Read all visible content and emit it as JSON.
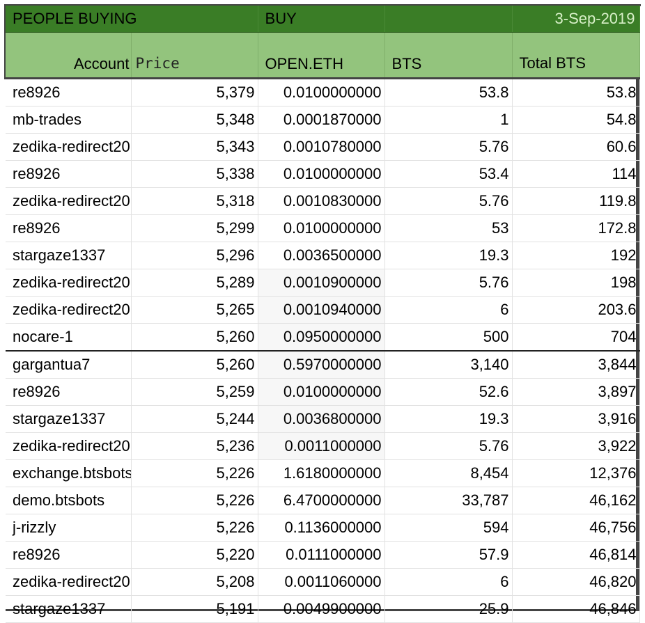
{
  "sheet": {
    "title_left": "PEOPLE BUYING",
    "title_mid": "BUY",
    "date": "3-Sep-2019",
    "headers": {
      "account": "Account",
      "price": "Price",
      "open_eth": "OPEN.ETH",
      "bts": "BTS",
      "total_bts": "Total BTS"
    },
    "rows": [
      {
        "account": "re8926",
        "price": "5,379",
        "eth": "0.0100000000",
        "bts": "53.8",
        "total": "53.8"
      },
      {
        "account": "mb-trades",
        "price": "5,348",
        "eth": "0.0001870000",
        "bts": "1",
        "total": "54.8"
      },
      {
        "account": "zedika-redirect20",
        "price": "5,343",
        "eth": "0.0010780000",
        "bts": "5.76",
        "total": "60.6"
      },
      {
        "account": "re8926",
        "price": "5,338",
        "eth": "0.0100000000",
        "bts": "53.4",
        "total": "114"
      },
      {
        "account": "zedika-redirect20",
        "price": "5,318",
        "eth": "0.0010830000",
        "bts": "5.76",
        "total": "119.8"
      },
      {
        "account": "re8926",
        "price": "5,299",
        "eth": "0.0100000000",
        "bts": "53",
        "total": "172.8"
      },
      {
        "account": "stargaze1337",
        "price": "5,296",
        "eth": "0.0036500000",
        "bts": "19.3",
        "total": "192"
      },
      {
        "account": "zedika-redirect20",
        "price": "5,289",
        "eth": "0.0010900000",
        "bts": "5.76",
        "total": "198"
      },
      {
        "account": "zedika-redirect20",
        "price": "5,265",
        "eth": "0.0010940000",
        "bts": "6",
        "total": "203.6"
      },
      {
        "account": "nocare-1",
        "price": "5,260",
        "eth": "0.0950000000",
        "bts": "500",
        "total": "704"
      },
      {
        "account": "gargantua7",
        "price": "5,260",
        "eth": "0.5970000000",
        "bts": "3,140",
        "total": "3,844"
      },
      {
        "account": "re8926",
        "price": "5,259",
        "eth": "0.0100000000",
        "bts": "52.6",
        "total": "3,897"
      },
      {
        "account": "stargaze1337",
        "price": "5,244",
        "eth": "0.0036800000",
        "bts": "19.3",
        "total": "3,916"
      },
      {
        "account": "zedika-redirect20",
        "price": "5,236",
        "eth": "0.0011000000",
        "bts": "5.76",
        "total": "3,922"
      },
      {
        "account": "exchange.btsbots",
        "price": "5,226",
        "eth": "1.6180000000",
        "bts": "8,454",
        "total": "12,376"
      },
      {
        "account": "demo.btsbots",
        "price": "5,226",
        "eth": "6.4700000000",
        "bts": "33,787",
        "total": "46,162"
      },
      {
        "account": "j-rizzly",
        "price": "5,226",
        "eth": "0.1136000000",
        "bts": "594",
        "total": "46,756"
      },
      {
        "account": "re8926",
        "price": "5,220",
        "eth": "0.0111000000",
        "bts": "57.9",
        "total": "46,814"
      },
      {
        "account": "zedika-redirect20",
        "price": "5,208",
        "eth": "0.0011060000",
        "bts": "6",
        "total": "46,820"
      },
      {
        "account": "stargaze1337",
        "price": "5,191",
        "eth": "0.0049900000",
        "bts": "25.9",
        "total": "46,846"
      }
    ]
  },
  "colors": {
    "title_bg": "#3a7d26",
    "header_bg": "#93c47d",
    "date_text": "#d8f0c8"
  }
}
